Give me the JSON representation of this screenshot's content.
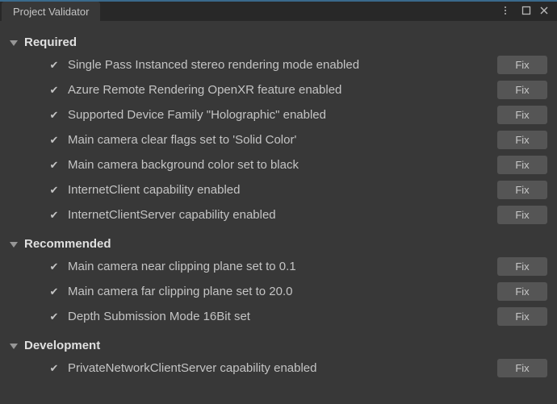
{
  "window": {
    "title": "Project Validator"
  },
  "buttons": {
    "fix_label": "Fix"
  },
  "sections": [
    {
      "id": "required",
      "title": "Required",
      "items": [
        {
          "checked": true,
          "label": "Single Pass Instanced stereo rendering mode enabled",
          "has_fix": true
        },
        {
          "checked": true,
          "label": "Azure Remote Rendering OpenXR feature enabled",
          "has_fix": true
        },
        {
          "checked": true,
          "label": "Supported Device Family \"Holographic\" enabled",
          "has_fix": true
        },
        {
          "checked": true,
          "label": "Main camera clear flags set to 'Solid Color'",
          "has_fix": true
        },
        {
          "checked": true,
          "label": "Main camera background color set to black",
          "has_fix": true
        },
        {
          "checked": true,
          "label": "InternetClient capability enabled",
          "has_fix": true
        },
        {
          "checked": true,
          "label": "InternetClientServer capability enabled",
          "has_fix": true
        }
      ]
    },
    {
      "id": "recommended",
      "title": "Recommended",
      "items": [
        {
          "checked": true,
          "label": "Main camera near clipping plane set to 0.1",
          "has_fix": true
        },
        {
          "checked": true,
          "label": "Main camera far clipping plane set to 20.0",
          "has_fix": true
        },
        {
          "checked": true,
          "label": "Depth Submission Mode 16Bit set",
          "has_fix": true
        }
      ]
    },
    {
      "id": "development",
      "title": "Development",
      "items": [
        {
          "checked": true,
          "label": "PrivateNetworkClientServer capability enabled",
          "has_fix": true
        }
      ]
    }
  ]
}
